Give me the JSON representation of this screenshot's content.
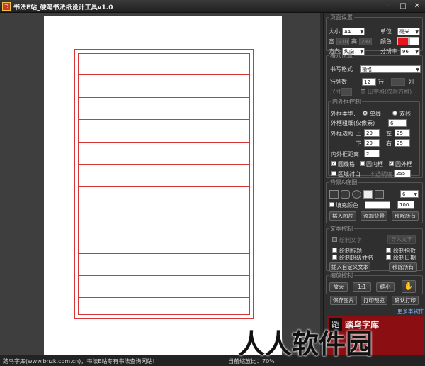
{
  "window": {
    "title": "书法E站_硬笔书法纸设计工具v1.0",
    "app_icon": "书",
    "minimize": "–",
    "maximize": "□",
    "close": "✕"
  },
  "page_settings": {
    "legend": "页面设置",
    "size_label": "大小",
    "size_value": "A4",
    "unit_label": "单位",
    "unit_value": "毫米",
    "width_label": "宽",
    "width_value": "210",
    "height_label": "高",
    "height_value": "297",
    "color_label": "颜色",
    "color_value": "#e8141c",
    "orientation_label": "方向",
    "orientation_value": "纵向",
    "resolution_label": "分辨率",
    "resolution_value": "96"
  },
  "format_settings": {
    "legend": "格式设置",
    "style_label": "书写格式",
    "style_value": "横格",
    "rows_label": "行列数",
    "rows_value": "12",
    "row_unit": "行",
    "cols_value": "",
    "col_unit": "列",
    "size_label": "尺寸",
    "size_value": "",
    "tianzige_label": "田字格(仅限方格)"
  },
  "frame_settings": {
    "legend": "内外框控制",
    "outer_type_label": "外框类型:",
    "single_label": "单线",
    "double_label": "双线",
    "thickness_label": "外框粗细(仅像素)",
    "thickness_value": "6",
    "margin_label": "外框边距",
    "top_label": "上",
    "top_value": "29",
    "left_label": "左",
    "left_value": "25",
    "bottom_label": "下",
    "bottom_value": "29",
    "right_label": "右",
    "right_value": "25",
    "gap_label": "内外框距离",
    "gap_value": "2",
    "circle_grid_label": "圆线格",
    "inner_frame_label": "圆内框",
    "outer_frame_label": "圆外框",
    "region_white_label": "区域衬白",
    "opacity_label": "不透明度",
    "opacity_value": "255"
  },
  "background_settings": {
    "legend": "背景&底图",
    "shape_value": "6",
    "fill_label": "填充颜色",
    "fill_value": "100",
    "insert_image_button": "插入图片",
    "add_background_button": "添加背景",
    "remove_all_button": "移除所有"
  },
  "text_settings": {
    "legend": "文本控制",
    "draw_text_label": "绘制文字",
    "import_text_button": "导入文字",
    "draw_title_label": "绘制标题",
    "draw_tip_label": "绘制指数",
    "draw_class_label": "绘制班级姓名",
    "draw_date_label": "绘制日期",
    "insert_custom_button": "插入自定义文本",
    "remove_all_button": "移除所有"
  },
  "zoom_control": {
    "legend": "缩放控制",
    "zoom_in_button": "放大",
    "actual_button": "1:1",
    "zoom_out_button": "缩小"
  },
  "actions": {
    "save_image_button": "保存图片",
    "print_preview_button": "打印预览",
    "confirm_print_button": "确认打印",
    "more_software_link": "更多本软件"
  },
  "logo": {
    "mark": "蹈",
    "text": "踏鸟字库"
  },
  "status": {
    "left_text": "踏鸟字库(www.bnzk.com.cn)，书法E站专有书法查询网站!",
    "zoom_text": "当前缩放比：70%"
  },
  "watermark": "人人软件园"
}
